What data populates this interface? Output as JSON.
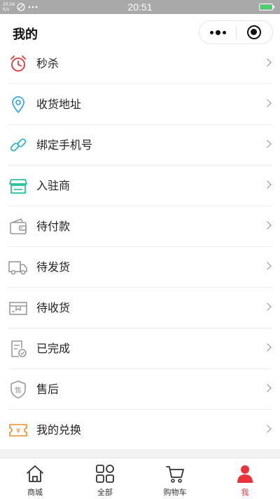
{
  "status_bar": {
    "signal_text": "20.56 K/s",
    "time": "20:51"
  },
  "header": {
    "title": "我的"
  },
  "menu": [
    {
      "label": "秒杀",
      "icon": "alarm-clock-icon",
      "color": "#e8333a"
    },
    {
      "label": "收货地址",
      "icon": "location-pin-icon",
      "color": "#3fa7f0"
    },
    {
      "label": "绑定手机号",
      "icon": "link-icon",
      "color": "#2ab6c8"
    },
    {
      "label": "入驻商",
      "icon": "storefront-icon",
      "color": "#2ac29c"
    },
    {
      "label": "待付款",
      "icon": "wallet-icon",
      "color": "#999999"
    },
    {
      "label": "待发货",
      "icon": "truck-icon",
      "color": "#999999"
    },
    {
      "label": "待收货",
      "icon": "package-icon",
      "color": "#999999"
    },
    {
      "label": "已完成",
      "icon": "completed-doc-icon",
      "color": "#999999"
    },
    {
      "label": "售后",
      "icon": "after-sales-shield-icon",
      "color": "#999999"
    },
    {
      "label": "我的兑换",
      "icon": "exchange-ticket-icon",
      "color": "#f08a2c"
    }
  ],
  "tab_bar": {
    "tabs": [
      {
        "label": "商城",
        "icon": "home-icon",
        "active": false
      },
      {
        "label": "全部",
        "icon": "categories-icon",
        "active": false
      },
      {
        "label": "购物车",
        "icon": "cart-icon",
        "active": false
      },
      {
        "label": "我",
        "icon": "person-icon",
        "active": true
      }
    ],
    "active_color": "#e8333a"
  }
}
